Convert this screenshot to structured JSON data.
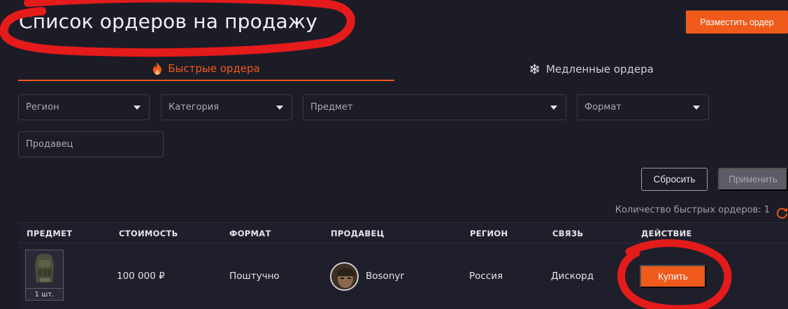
{
  "header": {
    "title": "Список ордеров на продажу",
    "place_order_label": "Разместить ордер"
  },
  "tabs": [
    {
      "label": "Быстрые ордера",
      "icon": "fire-icon",
      "active": true
    },
    {
      "label": "Медленные ордера",
      "icon": "snowflake-icon",
      "active": false
    }
  ],
  "filters": {
    "region": "Регион",
    "category": "Категория",
    "item": "Предмет",
    "format": "Формат",
    "seller_placeholder": "Продавец"
  },
  "actions": {
    "reset_label": "Сбросить",
    "apply_label": "Применить"
  },
  "count_text": "Количество быстрых ордеров: 1",
  "table": {
    "headers": [
      "ПРЕДМЕТ",
      "СТОИМОСТЬ",
      "ФОРМАТ",
      "ПРОДАВЕЦ",
      "РЕГИОН",
      "СВЯЗЬ",
      "ДЕЙСТВИЕ"
    ],
    "rows": [
      {
        "qty": "1 шт.",
        "price": "100 000 ₽",
        "format": "Поштучно",
        "seller": "Bosonyr",
        "region": "Россия",
        "contact": "Дискорд",
        "action_label": "Купить"
      }
    ]
  },
  "colors": {
    "accent": "#f05a1a",
    "background": "#1c1c27",
    "annotation": "#e31b1b"
  }
}
